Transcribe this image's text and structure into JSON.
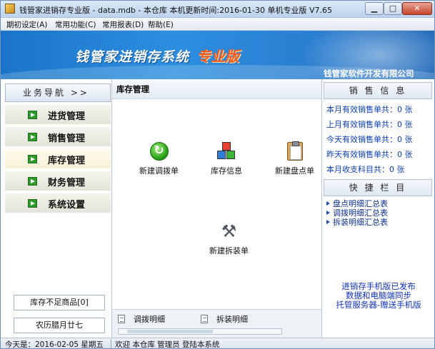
{
  "window": {
    "title": "钱管家进销存专业版 - data.mdb - 本仓库  本机更新时间:2016-01-30 单机专业版 V7.65",
    "controls": {
      "minimize": "▁",
      "maximize": "□",
      "close": "✕"
    }
  },
  "menu": [
    {
      "label": "期初设定(A)"
    },
    {
      "label": "常用功能(C)"
    },
    {
      "label": "常用报表(D)"
    },
    {
      "label": "帮助(E)"
    }
  ],
  "banner": {
    "title": "钱管家进销存系统",
    "edition": "专业版",
    "company": "钱管家软件开发有限公司"
  },
  "nav": {
    "header": "业务导航  >>",
    "items": [
      {
        "label": "进货管理"
      },
      {
        "label": "销售管理"
      },
      {
        "label": "库存管理"
      },
      {
        "label": "财务管理"
      },
      {
        "label": "系统设置"
      }
    ],
    "active_index": 2,
    "stock_shortage_button": "库存不足商品[0]",
    "lunar_date": "农历腊月廿七"
  },
  "main": {
    "title": "库存管理",
    "functions": [
      {
        "label": "新建调拨单",
        "icon": "refresh-icon"
      },
      {
        "label": "库存信息",
        "icon": "blocks-icon"
      },
      {
        "label": "新建盘点单",
        "icon": "clipboard-icon"
      },
      {
        "label": "新建拆装单",
        "icon": "tools-icon"
      }
    ],
    "bottom_tabs": [
      {
        "label": "调拨明细"
      },
      {
        "label": "拆装明细"
      }
    ]
  },
  "sales_info": {
    "header": "销 售 信 息",
    "lines": [
      "本月有效销售单共：0 张",
      "上月有效销售单共：0 张",
      "今天有效销售单共：0 张",
      "昨天有效销售单共：0 张",
      "本月收支科目共：0 张"
    ]
  },
  "quick_bar": {
    "header": "快 捷 栏 目",
    "links": [
      "盘点明细汇总表",
      "调拨明细汇总表",
      "拆装明细汇总表"
    ]
  },
  "promo": {
    "lines": [
      "进销存手机版已发布",
      "数据和电脑端同步",
      "托管服务器-赠送手机版"
    ]
  },
  "status": {
    "today": "今天是：2016-02-05  星期五",
    "welcome": "欢迎 本仓库 管理员  登陆本系统"
  },
  "colors": {
    "banner_blue": "#2d8ee0",
    "nav_arrow_green": "#2f9a2c",
    "sales_text_blue": "#0b3fb4",
    "promo_blue": "#1233b8",
    "edition_orange": "#ff5a1f"
  }
}
